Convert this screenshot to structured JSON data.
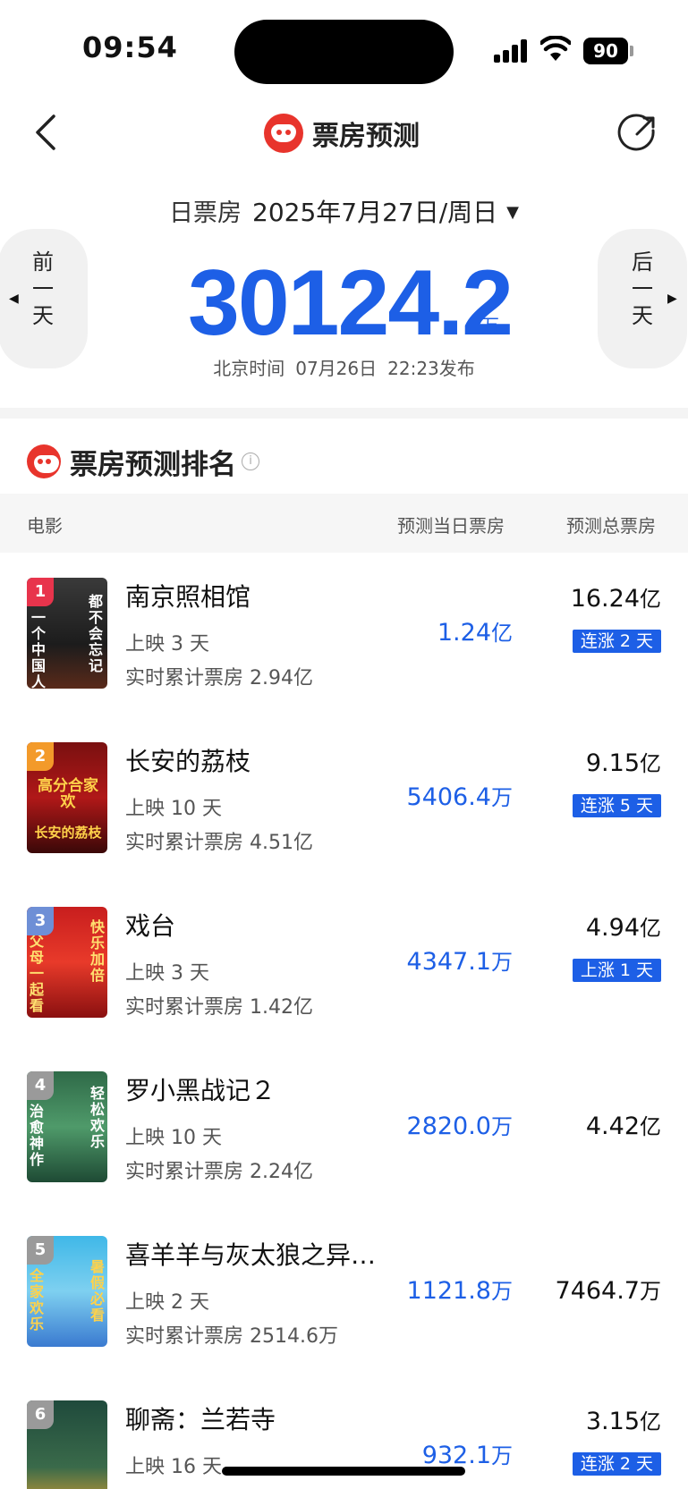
{
  "status": {
    "time": "09:54",
    "battery": "90"
  },
  "nav": {
    "title": "票房预测"
  },
  "date": {
    "label": "日票房",
    "value": "2025年7月27日/周日"
  },
  "prev_day": {
    "label": "前一天"
  },
  "next_day": {
    "label": "后一天"
  },
  "forecast": {
    "value": "30124.2",
    "unit": "万",
    "publish_prefix": "北京时间",
    "publish_date": "07月26日",
    "publish_time": "22:23发布"
  },
  "section": {
    "title": "票房预测排名"
  },
  "table_headers": {
    "movie": "电影",
    "day": "预测当日票房",
    "total": "预测总票房"
  },
  "movies": [
    {
      "rank": "1",
      "title": "南京照相馆",
      "days": "上映 3 天",
      "cumulative": "实时累计票房 2.94亿",
      "day_box": "1.24",
      "day_unit": "亿",
      "total_box": "16.24",
      "total_unit": "亿",
      "trend": "连涨 2 天",
      "poster_text_a": "一个中国人",
      "poster_text_b": "都不会忘记"
    },
    {
      "rank": "2",
      "title": "长安的荔枝",
      "days": "上映 10 天",
      "cumulative": "实时累计票房 4.51亿",
      "day_box": "5406.4",
      "day_unit": "万",
      "total_box": "9.15",
      "total_unit": "亿",
      "trend": "连涨 5 天",
      "poster_text_a": "高分合家欢",
      "poster_text_b": "长安的荔枝"
    },
    {
      "rank": "3",
      "title": "戏台",
      "days": "上映 3 天",
      "cumulative": "实时累计票房 1.42亿",
      "day_box": "4347.1",
      "day_unit": "万",
      "total_box": "4.94",
      "total_unit": "亿",
      "trend": "上涨 1 天",
      "poster_text_a": "父母一起看",
      "poster_text_b": "快乐加倍"
    },
    {
      "rank": "4",
      "title": "罗小黑战记２",
      "days": "上映 10 天",
      "cumulative": "实时累计票房 2.24亿",
      "day_box": "2820.0",
      "day_unit": "万",
      "total_box": "4.42",
      "total_unit": "亿",
      "trend": "",
      "poster_text_a": "治愈神作",
      "poster_text_b": "轻松欢乐"
    },
    {
      "rank": "5",
      "title": "喜羊羊与灰太狼之异…",
      "days": "上映 2 天",
      "cumulative": "实时累计票房 2514.6万",
      "day_box": "1121.8",
      "day_unit": "万",
      "total_box": "7464.7",
      "total_unit": "万",
      "trend": "",
      "poster_text_a": "全家欢乐",
      "poster_text_b": "暑假必看"
    },
    {
      "rank": "6",
      "title": "聊斋：兰若寺",
      "days": "上映 16 天",
      "cumulative": "",
      "day_box": "932.1",
      "day_unit": "万",
      "total_box": "3.15",
      "total_unit": "亿",
      "trend": "连涨 2 天",
      "poster_text_a": "",
      "poster_text_b": ""
    }
  ],
  "colors": {
    "accent": "#1d5fe6",
    "brand_red": "#e8342c",
    "rank1": "#e8344c",
    "rank2": "#f39a2a",
    "rank3": "#6e8fd6",
    "rank_other": "#9a9a9a"
  },
  "icons": {
    "back": "chevron-left-icon",
    "share": "share-icon",
    "info": "info-icon",
    "logo": "maoyan-cat-logo"
  }
}
